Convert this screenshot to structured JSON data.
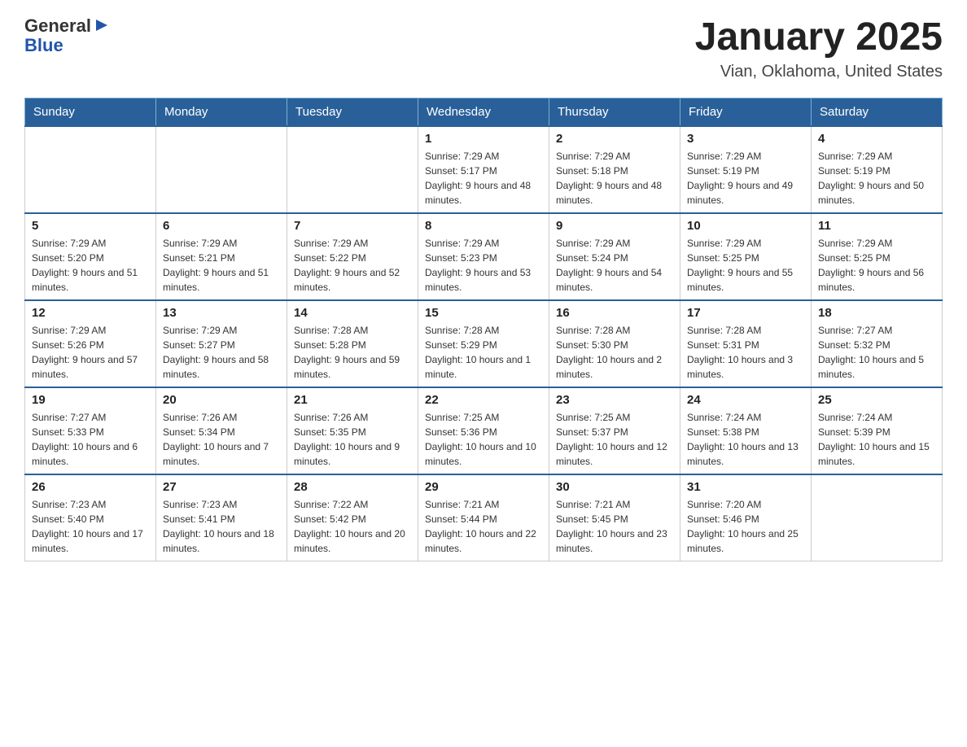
{
  "header": {
    "logo": {
      "general": "General",
      "triangle": "▶",
      "blue": "Blue"
    },
    "title": "January 2025",
    "location": "Vian, Oklahoma, United States"
  },
  "calendar": {
    "days_of_week": [
      "Sunday",
      "Monday",
      "Tuesday",
      "Wednesday",
      "Thursday",
      "Friday",
      "Saturday"
    ],
    "weeks": [
      [
        {
          "day": "",
          "info": ""
        },
        {
          "day": "",
          "info": ""
        },
        {
          "day": "",
          "info": ""
        },
        {
          "day": "1",
          "info": "Sunrise: 7:29 AM\nSunset: 5:17 PM\nDaylight: 9 hours and 48 minutes."
        },
        {
          "day": "2",
          "info": "Sunrise: 7:29 AM\nSunset: 5:18 PM\nDaylight: 9 hours and 48 minutes."
        },
        {
          "day": "3",
          "info": "Sunrise: 7:29 AM\nSunset: 5:19 PM\nDaylight: 9 hours and 49 minutes."
        },
        {
          "day": "4",
          "info": "Sunrise: 7:29 AM\nSunset: 5:19 PM\nDaylight: 9 hours and 50 minutes."
        }
      ],
      [
        {
          "day": "5",
          "info": "Sunrise: 7:29 AM\nSunset: 5:20 PM\nDaylight: 9 hours and 51 minutes."
        },
        {
          "day": "6",
          "info": "Sunrise: 7:29 AM\nSunset: 5:21 PM\nDaylight: 9 hours and 51 minutes."
        },
        {
          "day": "7",
          "info": "Sunrise: 7:29 AM\nSunset: 5:22 PM\nDaylight: 9 hours and 52 minutes."
        },
        {
          "day": "8",
          "info": "Sunrise: 7:29 AM\nSunset: 5:23 PM\nDaylight: 9 hours and 53 minutes."
        },
        {
          "day": "9",
          "info": "Sunrise: 7:29 AM\nSunset: 5:24 PM\nDaylight: 9 hours and 54 minutes."
        },
        {
          "day": "10",
          "info": "Sunrise: 7:29 AM\nSunset: 5:25 PM\nDaylight: 9 hours and 55 minutes."
        },
        {
          "day": "11",
          "info": "Sunrise: 7:29 AM\nSunset: 5:25 PM\nDaylight: 9 hours and 56 minutes."
        }
      ],
      [
        {
          "day": "12",
          "info": "Sunrise: 7:29 AM\nSunset: 5:26 PM\nDaylight: 9 hours and 57 minutes."
        },
        {
          "day": "13",
          "info": "Sunrise: 7:29 AM\nSunset: 5:27 PM\nDaylight: 9 hours and 58 minutes."
        },
        {
          "day": "14",
          "info": "Sunrise: 7:28 AM\nSunset: 5:28 PM\nDaylight: 9 hours and 59 minutes."
        },
        {
          "day": "15",
          "info": "Sunrise: 7:28 AM\nSunset: 5:29 PM\nDaylight: 10 hours and 1 minute."
        },
        {
          "day": "16",
          "info": "Sunrise: 7:28 AM\nSunset: 5:30 PM\nDaylight: 10 hours and 2 minutes."
        },
        {
          "day": "17",
          "info": "Sunrise: 7:28 AM\nSunset: 5:31 PM\nDaylight: 10 hours and 3 minutes."
        },
        {
          "day": "18",
          "info": "Sunrise: 7:27 AM\nSunset: 5:32 PM\nDaylight: 10 hours and 5 minutes."
        }
      ],
      [
        {
          "day": "19",
          "info": "Sunrise: 7:27 AM\nSunset: 5:33 PM\nDaylight: 10 hours and 6 minutes."
        },
        {
          "day": "20",
          "info": "Sunrise: 7:26 AM\nSunset: 5:34 PM\nDaylight: 10 hours and 7 minutes."
        },
        {
          "day": "21",
          "info": "Sunrise: 7:26 AM\nSunset: 5:35 PM\nDaylight: 10 hours and 9 minutes."
        },
        {
          "day": "22",
          "info": "Sunrise: 7:25 AM\nSunset: 5:36 PM\nDaylight: 10 hours and 10 minutes."
        },
        {
          "day": "23",
          "info": "Sunrise: 7:25 AM\nSunset: 5:37 PM\nDaylight: 10 hours and 12 minutes."
        },
        {
          "day": "24",
          "info": "Sunrise: 7:24 AM\nSunset: 5:38 PM\nDaylight: 10 hours and 13 minutes."
        },
        {
          "day": "25",
          "info": "Sunrise: 7:24 AM\nSunset: 5:39 PM\nDaylight: 10 hours and 15 minutes."
        }
      ],
      [
        {
          "day": "26",
          "info": "Sunrise: 7:23 AM\nSunset: 5:40 PM\nDaylight: 10 hours and 17 minutes."
        },
        {
          "day": "27",
          "info": "Sunrise: 7:23 AM\nSunset: 5:41 PM\nDaylight: 10 hours and 18 minutes."
        },
        {
          "day": "28",
          "info": "Sunrise: 7:22 AM\nSunset: 5:42 PM\nDaylight: 10 hours and 20 minutes."
        },
        {
          "day": "29",
          "info": "Sunrise: 7:21 AM\nSunset: 5:44 PM\nDaylight: 10 hours and 22 minutes."
        },
        {
          "day": "30",
          "info": "Sunrise: 7:21 AM\nSunset: 5:45 PM\nDaylight: 10 hours and 23 minutes."
        },
        {
          "day": "31",
          "info": "Sunrise: 7:20 AM\nSunset: 5:46 PM\nDaylight: 10 hours and 25 minutes."
        },
        {
          "day": "",
          "info": ""
        }
      ]
    ]
  }
}
